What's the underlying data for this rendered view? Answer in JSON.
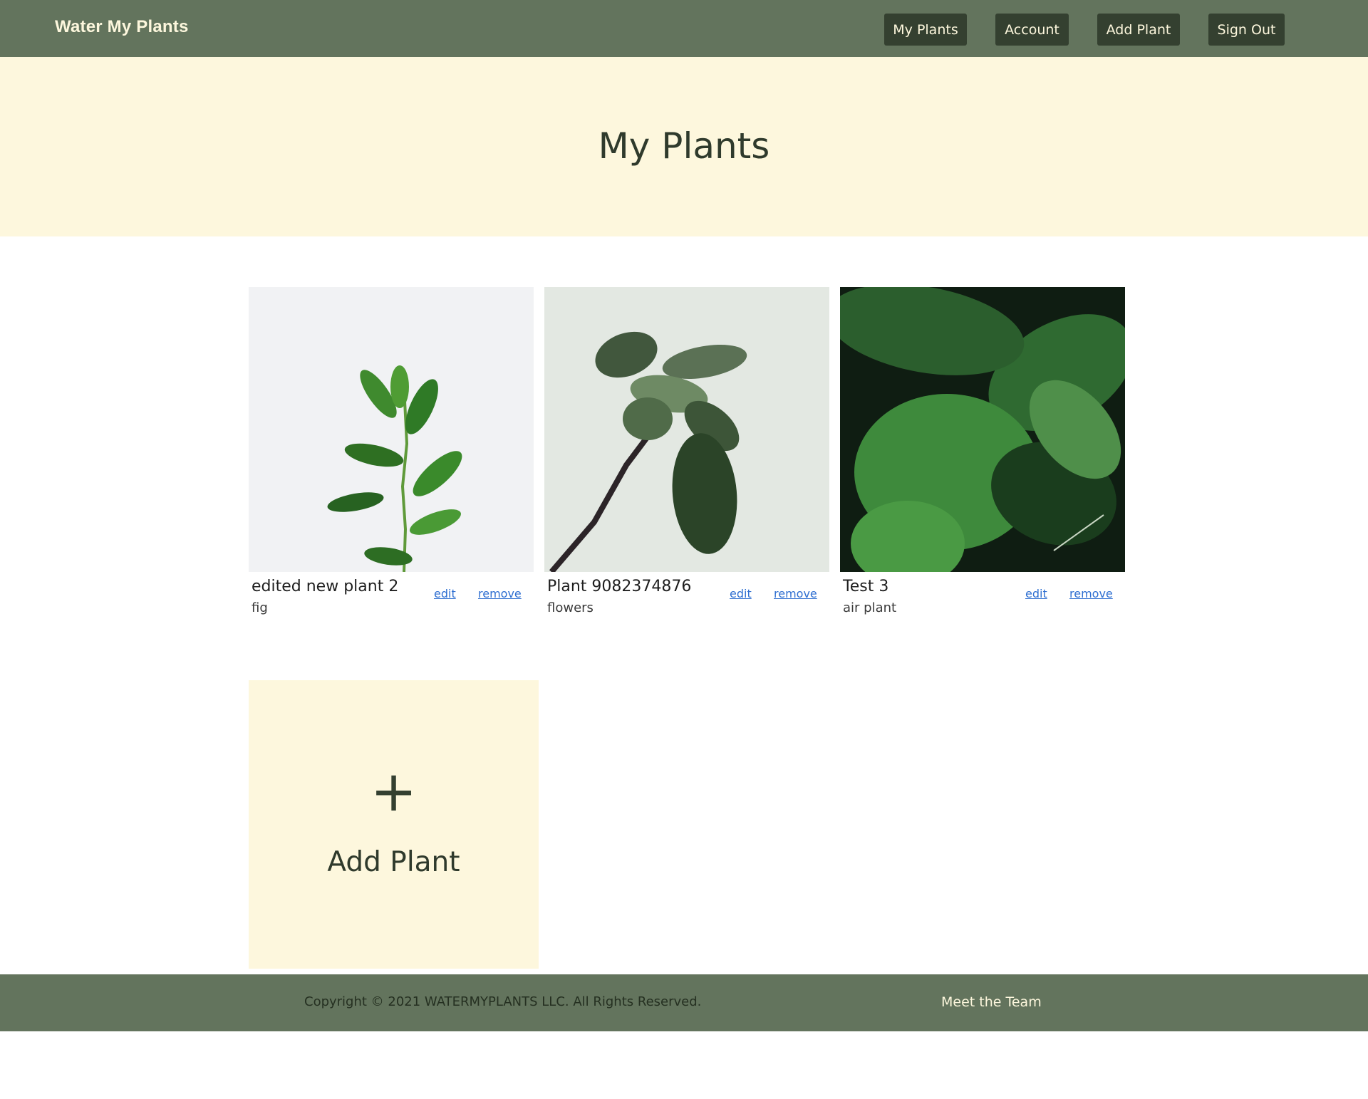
{
  "header": {
    "brand": "Water My Plants",
    "nav": {
      "my_plants": "My Plants",
      "account": "Account",
      "add_plant": "Add Plant",
      "sign_out": "Sign Out"
    }
  },
  "hero": {
    "title": "My Plants"
  },
  "plants": [
    {
      "name": "edited new plant 2",
      "species": "fig",
      "edit_label": "edit",
      "remove_label": "remove",
      "image": "ficus-plant-photo"
    },
    {
      "name": "Plant 9082374876",
      "species": "flowers",
      "edit_label": "edit",
      "remove_label": "remove",
      "image": "fiddle-leaf-branch-photo"
    },
    {
      "name": "Test 3",
      "species": "air plant",
      "edit_label": "edit",
      "remove_label": "remove",
      "image": "monstera-fern-photo"
    }
  ],
  "add_tile": {
    "icon": "+",
    "label": "Add Plant"
  },
  "footer": {
    "copyright": "Copyright © 2021 WATERMYPLANTS LLC. All Rights Reserved.",
    "team_link": "Meet the Team"
  },
  "colors": {
    "header_bg": "#63745d",
    "hero_bg": "#fdf7dd",
    "nav_button_bg": "#344030",
    "link": "#2f6fd1"
  }
}
